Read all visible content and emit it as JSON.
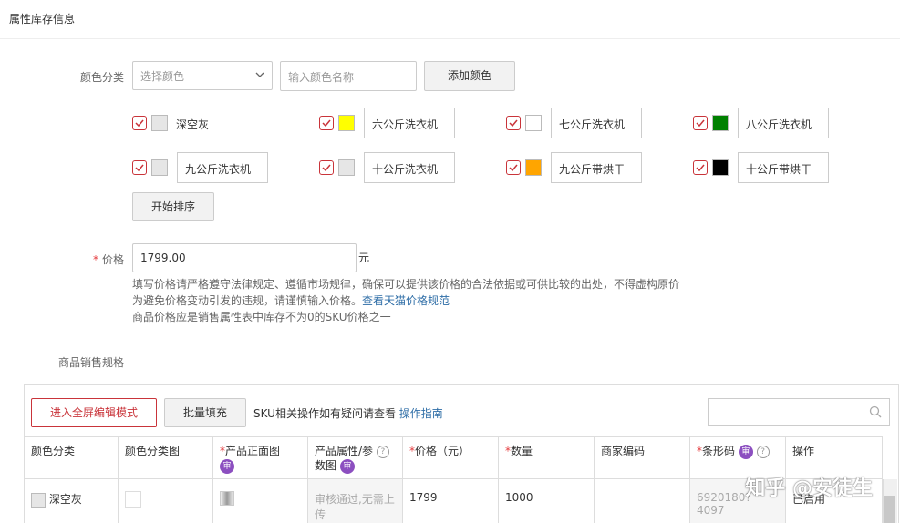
{
  "section_title": "属性库存信息",
  "color": {
    "label": "颜色分类",
    "select_placeholder": "选择颜色",
    "name_input_placeholder": "输入颜色名称",
    "add_button": "添加颜色",
    "items": [
      {
        "name": "深空灰",
        "swatch": "#e6e6e6",
        "boxed": false
      },
      {
        "name": "六公斤洗衣机",
        "swatch": "#ffff00",
        "boxed": true
      },
      {
        "name": "七公斤洗衣机",
        "swatch": "#ffffff",
        "boxed": true
      },
      {
        "name": "八公斤洗衣机",
        "swatch": "#008000",
        "boxed": true
      },
      {
        "name": "九公斤洗衣机",
        "swatch": "#e6e6e6",
        "boxed": true
      },
      {
        "name": "十公斤洗衣机",
        "swatch": "#e6e6e6",
        "boxed": true
      },
      {
        "name": "九公斤带烘干",
        "swatch": "#ffa500",
        "boxed": true
      },
      {
        "name": "十公斤带烘干",
        "swatch": "#000000",
        "boxed": true
      }
    ],
    "sort_button": "开始排序"
  },
  "price": {
    "required_mark": "*",
    "label": "价格",
    "value": "1799.00",
    "unit": "元",
    "help_line1": "填写价格请严格遵守法律规定、遵循市场规律，确保可以提供该价格的合法依据或可供比较的出处，不得虚构原价",
    "help_line2": "为避免价格变动引发的违规，请谨慎输入价格。",
    "help_link": "查看天猫价格规范",
    "help_line3": "商品价格应是销售属性表中库存不为0的SKU价格之一"
  },
  "sku": {
    "section_label": "商品销售规格",
    "fullscreen_button": "进入全屏编辑模式",
    "batch_fill_button": "批量填充",
    "hint_text": "SKU相关操作如有疑问请查看",
    "hint_link": "操作指南",
    "search_placeholder": "",
    "headers": {
      "color_category": "颜色分类",
      "color_image": "颜色分类图",
      "front_image": "产品正面图",
      "attr_image_a": "产品属性/参",
      "attr_image_b": "数图",
      "price": "价格（元）",
      "quantity": "数量",
      "merchant_code": "商家编码",
      "barcode": "条形码",
      "action": "操作"
    },
    "review_badge": "审",
    "help_badge": "?",
    "row": {
      "color_name": "深空灰",
      "attr_image_text_a": "审核通过,无需上",
      "attr_image_text_b": "传",
      "price": "1799",
      "quantity": "1000",
      "merchant_code": "",
      "barcode": "6920180?4097",
      "status": "已启用"
    }
  },
  "watermark": "知乎 @安徒生",
  "colors": {
    "accent_red": "#c9343a",
    "link_blue": "#2f6ea7",
    "review_purple": "#8c4fc0"
  }
}
